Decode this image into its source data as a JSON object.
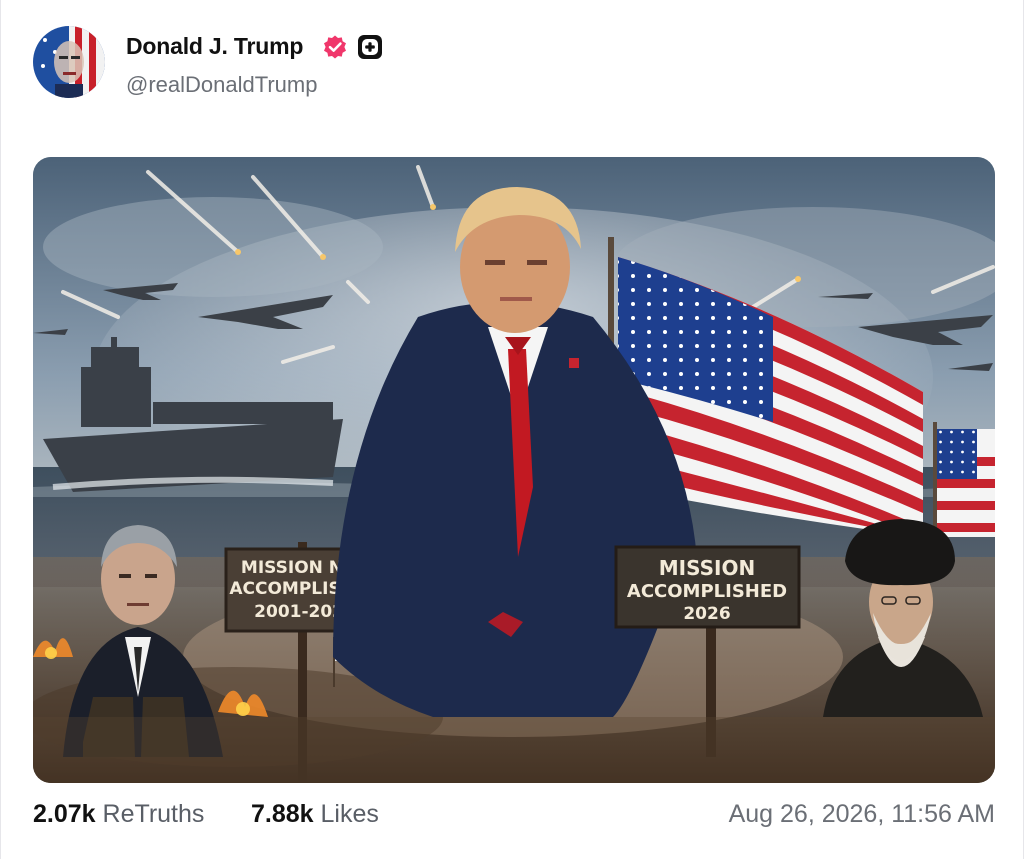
{
  "author": {
    "display_name": "Donald J. Trump",
    "handle": "@realDonaldTrump",
    "avatar_icon": "avatar-image",
    "verified_icon": "verified-badge-icon",
    "verified_color": "#f0376b",
    "plus_icon": "plus-badge-icon"
  },
  "media": {
    "left_sign": {
      "line1": "MISSION NOT",
      "line2": "ACCOMPLISHED",
      "line3": "2001-2021"
    },
    "right_sign": {
      "line1": "MISSION",
      "line2": "ACCOMPLISHED",
      "line3": "2026"
    }
  },
  "stats": {
    "retruths_count": "2.07k",
    "retruths_label": "ReTruths",
    "likes_count": "7.88k",
    "likes_label": "Likes"
  },
  "timestamp": "Aug 26, 2026, 11:56 AM"
}
